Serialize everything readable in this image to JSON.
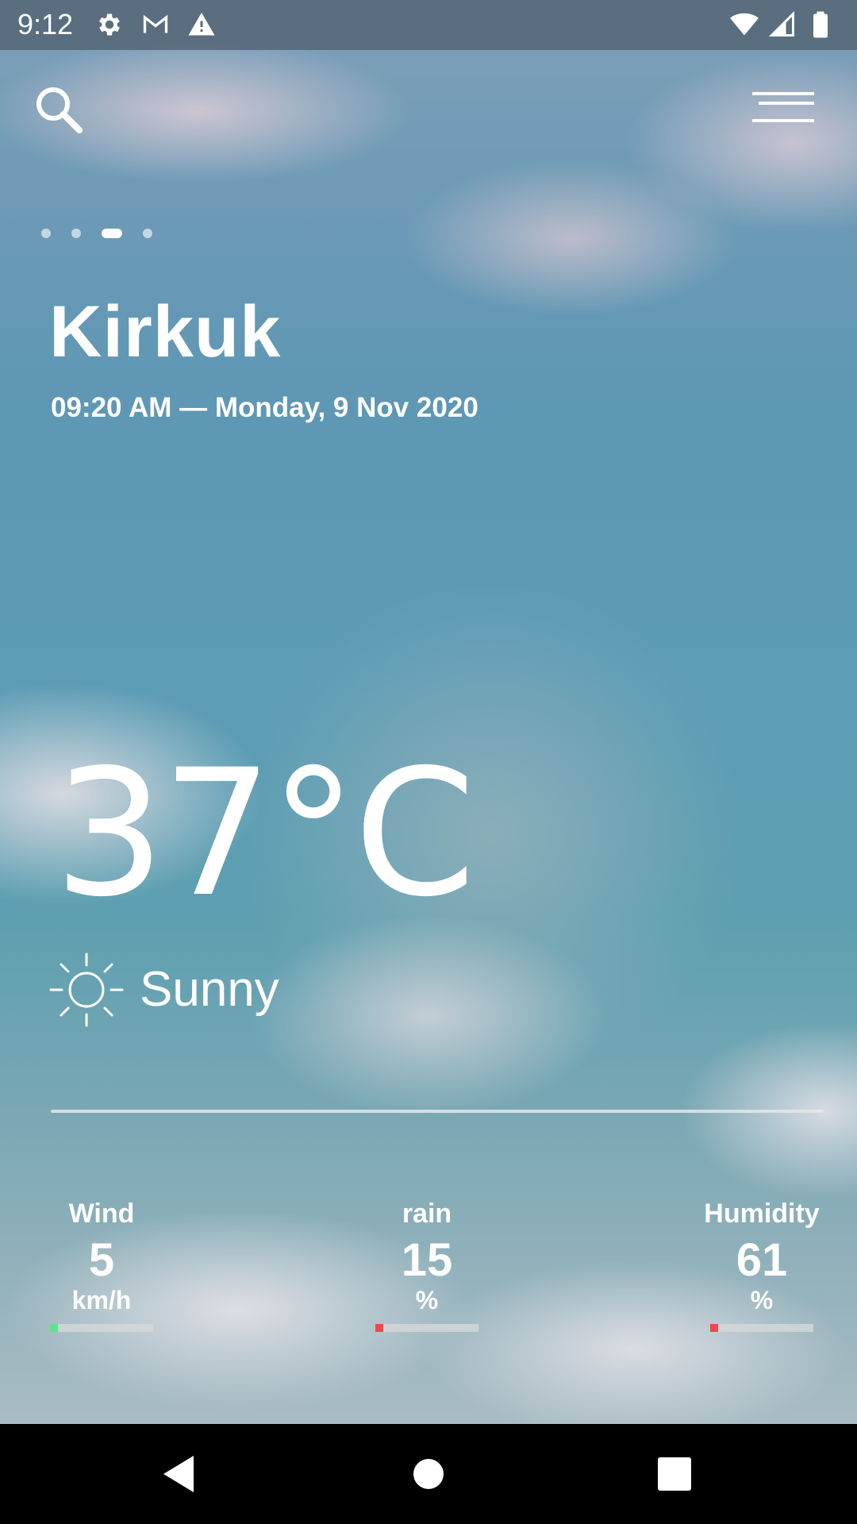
{
  "status_bar": {
    "time": "9:12",
    "left_icons": [
      "gear-icon",
      "gmail-icon",
      "warning-icon"
    ],
    "right_icons": [
      "wifi-icon",
      "signal-icon",
      "battery-icon"
    ]
  },
  "header": {
    "search_icon": "search-icon",
    "menu_icon": "menu-icon"
  },
  "pager": {
    "count": 4,
    "active_index": 2
  },
  "location": {
    "city": "Kirkuk",
    "datetime": "09:20 AM — Monday, 9 Nov 2020"
  },
  "weather": {
    "temperature": "37°C",
    "condition": "Sunny",
    "condition_icon": "sun-icon"
  },
  "metrics": [
    {
      "label": "Wind",
      "value": "5",
      "unit": "km/h",
      "level": 0.08,
      "color": "#5fe38a"
    },
    {
      "label": "rain",
      "value": "15",
      "unit": "%",
      "level": 0.08,
      "color": "#f04848"
    },
    {
      "label": "Humidity",
      "value": "61",
      "unit": "%",
      "level": 0.08,
      "color": "#f04848"
    }
  ],
  "nav_bar": {
    "icons": [
      "back-icon",
      "home-icon",
      "recents-icon"
    ]
  }
}
